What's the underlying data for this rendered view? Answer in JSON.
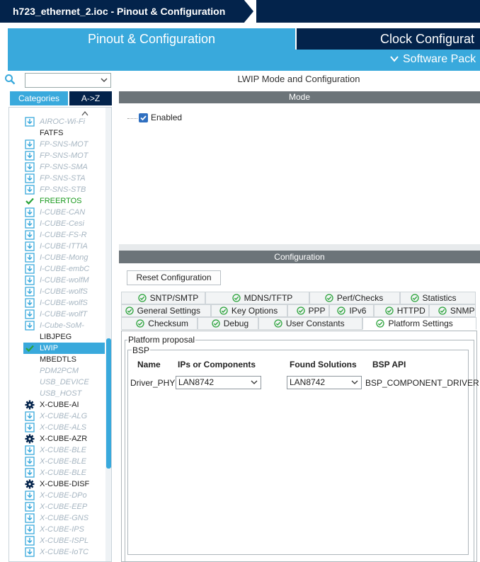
{
  "window": {
    "title": "h723_ethernet_2.ioc - Pinout & Configuration"
  },
  "tabs": {
    "pinout": "Pinout & Configuration",
    "clock": "Clock Configurat",
    "software_packs": "Software Pack"
  },
  "left": {
    "search_value": "",
    "categories_tab": "Categories",
    "az_tab": "A->Z",
    "items": [
      {
        "label": "AIROC-Wi-Fi",
        "style": "dim",
        "icon": "download-icon"
      },
      {
        "label": "FATFS",
        "style": "norm",
        "icon": "none"
      },
      {
        "label": "FP-SNS-MOT",
        "style": "dim",
        "icon": "download-icon"
      },
      {
        "label": "FP-SNS-MOT",
        "style": "dim",
        "icon": "download-icon"
      },
      {
        "label": "FP-SNS-SMA",
        "style": "dim",
        "icon": "download-icon"
      },
      {
        "label": "FP-SNS-STA",
        "style": "dim",
        "icon": "download-icon"
      },
      {
        "label": "FP-SNS-STB",
        "style": "dim",
        "icon": "download-icon"
      },
      {
        "label": "FREERTOS",
        "style": "green",
        "icon": "check-icon"
      },
      {
        "label": "I-CUBE-CAN",
        "style": "dim",
        "icon": "download-icon"
      },
      {
        "label": "I-CUBE-Cesi",
        "style": "dim",
        "icon": "download-icon"
      },
      {
        "label": "I-CUBE-FS-R",
        "style": "dim",
        "icon": "download-icon"
      },
      {
        "label": "I-CUBE-ITTIA",
        "style": "dim",
        "icon": "download-icon"
      },
      {
        "label": "I-CUBE-Mong",
        "style": "dim",
        "icon": "download-icon"
      },
      {
        "label": "I-CUBE-embC",
        "style": "dim",
        "icon": "download-icon"
      },
      {
        "label": "I-CUBE-wolfM",
        "style": "dim",
        "icon": "download-icon"
      },
      {
        "label": "I-CUBE-wolfS",
        "style": "dim",
        "icon": "download-icon"
      },
      {
        "label": "I-CUBE-wolfS",
        "style": "dim",
        "icon": "download-icon"
      },
      {
        "label": "I-CUBE-wolfT",
        "style": "dim",
        "icon": "download-icon"
      },
      {
        "label": "I-Cube-SoM-",
        "style": "dim",
        "icon": "download-icon"
      },
      {
        "label": "LIBJPEG",
        "style": "norm",
        "icon": "none"
      },
      {
        "label": "LWIP",
        "style": "sel",
        "icon": "check-icon"
      },
      {
        "label": "MBEDTLS",
        "style": "norm",
        "icon": "none"
      },
      {
        "label": "PDM2PCM",
        "style": "dim",
        "icon": "none"
      },
      {
        "label": "USB_DEVICE",
        "style": "dim",
        "icon": "none"
      },
      {
        "label": "USB_HOST",
        "style": "dim",
        "icon": "none"
      },
      {
        "label": "X-CUBE-AI",
        "style": "norm",
        "icon": "gear-icon"
      },
      {
        "label": "X-CUBE-ALG",
        "style": "dim",
        "icon": "download-icon"
      },
      {
        "label": "X-CUBE-ALS",
        "style": "dim",
        "icon": "download-icon"
      },
      {
        "label": "X-CUBE-AZR",
        "style": "norm",
        "icon": "gear-icon"
      },
      {
        "label": "X-CUBE-BLE",
        "style": "dim",
        "icon": "download-icon"
      },
      {
        "label": "X-CUBE-BLE",
        "style": "dim",
        "icon": "download-icon"
      },
      {
        "label": "X-CUBE-BLE",
        "style": "dim",
        "icon": "download-icon"
      },
      {
        "label": "X-CUBE-DISF",
        "style": "norm",
        "icon": "gear-icon"
      },
      {
        "label": "X-CUBE-DPo",
        "style": "dim",
        "icon": "download-icon"
      },
      {
        "label": "X-CUBE-EEP",
        "style": "dim",
        "icon": "download-icon"
      },
      {
        "label": "X-CUBE-GNS",
        "style": "dim",
        "icon": "download-icon"
      },
      {
        "label": "X-CUBE-IPS",
        "style": "dim",
        "icon": "download-icon"
      },
      {
        "label": "X-CUBE-ISPL",
        "style": "dim",
        "icon": "download-icon"
      },
      {
        "label": "X-CUBE-IoTC",
        "style": "dim",
        "icon": "download-icon"
      }
    ]
  },
  "right": {
    "title": "LWIP Mode and Configuration",
    "mode_header": "Mode",
    "enabled_label": "Enabled",
    "config_header": "Configuration",
    "reset_label": "Reset Configuration",
    "tabs_row1": [
      "SNTP/SMTP",
      "MDNS/TFTP",
      "Perf/Checks",
      "Statistics"
    ],
    "tabs_row2": [
      "General Settings",
      "Key Options",
      "PPP",
      "IPv6",
      "HTTPD",
      "SNMP"
    ],
    "tabs_row3": [
      "Checksum",
      "Debug",
      "User Constants",
      "Platform Settings"
    ],
    "platform_legend": "Platform proposal",
    "bsp_legend": "BSP",
    "columns": [
      "Name",
      "IPs or Components",
      "Found Solutions",
      "BSP API"
    ],
    "row": {
      "name": "Driver_PHY",
      "ip": "LAN8742",
      "solution": "LAN8742",
      "api": "BSP_COMPONENT_DRIVER"
    }
  },
  "colors": {
    "navy": "#03234b",
    "accent": "#39a9dc",
    "check_green": "#1b9a1f",
    "header_gray": "#6c7479"
  }
}
